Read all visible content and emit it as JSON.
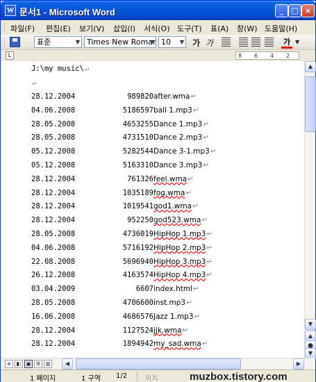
{
  "window": {
    "title": "문서1 - Microsoft Word",
    "title_icon": "W",
    "minimize_icon": "_",
    "maximize_icon": "□",
    "close_icon": "×"
  },
  "menu": [
    "파일(F)",
    "편집(E)",
    "보기(V)",
    "삽입(I)",
    "서식(O)",
    "도구(T)",
    "표(A)",
    "창(W)",
    "도움말(H)"
  ],
  "toolbar": {
    "style": "표준",
    "font": "Times New Roman",
    "size": "10",
    "bold": "가",
    "italic": "가",
    "font_color_label": "가",
    "font_color": "#e00000"
  },
  "ruler": {
    "corner_icon": "L",
    "ticks": [
      "8",
      "6",
      "4",
      "2"
    ]
  },
  "document": {
    "path": "J:\\my music\\",
    "paragraph_mark": "↵",
    "rows": [
      {
        "date": "28.12.2004",
        "size": "989820",
        "name": "after.wma"
      },
      {
        "date": "04.06.2008",
        "size": "5186597",
        "name": "ball 1.mp3"
      },
      {
        "date": "28.05.2008",
        "size": "4653255",
        "name": "Dance 1.mp3"
      },
      {
        "date": "28.05.2008",
        "size": "4731510",
        "name": "Dance 2.mp3"
      },
      {
        "date": "05.12.2008",
        "size": "5282544",
        "name": "Dance 3-1.mp3"
      },
      {
        "date": "05.12.2008",
        "size": "5163310",
        "name": "Dance 3.mp3"
      },
      {
        "date": "28.12.2004",
        "size": "761326",
        "name": "feel.wma"
      },
      {
        "date": "28.12.2004",
        "size": "1035189",
        "name": "fog.wma"
      },
      {
        "date": "28.12.2004",
        "size": "1019541",
        "name": "god1.wma"
      },
      {
        "date": "28.12.2004",
        "size": "952250",
        "name": "god523.wma"
      },
      {
        "date": "28.05.2008",
        "size": "4736019",
        "name": "HipHop 1.mp3"
      },
      {
        "date": "04.06.2008",
        "size": "5716192",
        "name": "HipHop 2.mp3"
      },
      {
        "date": "22.08.2008",
        "size": "5696940",
        "name": "HipHop 3.mp3"
      },
      {
        "date": "26.12.2008",
        "size": "4163574",
        "name": "HipHop 4.mp3"
      },
      {
        "date": "03.04.2009",
        "size": "6607",
        "name": "index.html"
      },
      {
        "date": "28.05.2008",
        "size": "4706600",
        "name": "inst.mp3"
      },
      {
        "date": "16.06.2008",
        "size": "4686576",
        "name": "Jazz 1.mp3"
      },
      {
        "date": "28.12.2004",
        "size": "1127524",
        "name": "jjk.wma"
      },
      {
        "date": "28.12.2004",
        "size": "1894942",
        "name": "my_sad.wma"
      }
    ]
  },
  "status": {
    "page": "1 페이지",
    "section": "1 구역",
    "page_count": "1/2",
    "position": "위치"
  },
  "watermark": "muzbox.tistory.com"
}
